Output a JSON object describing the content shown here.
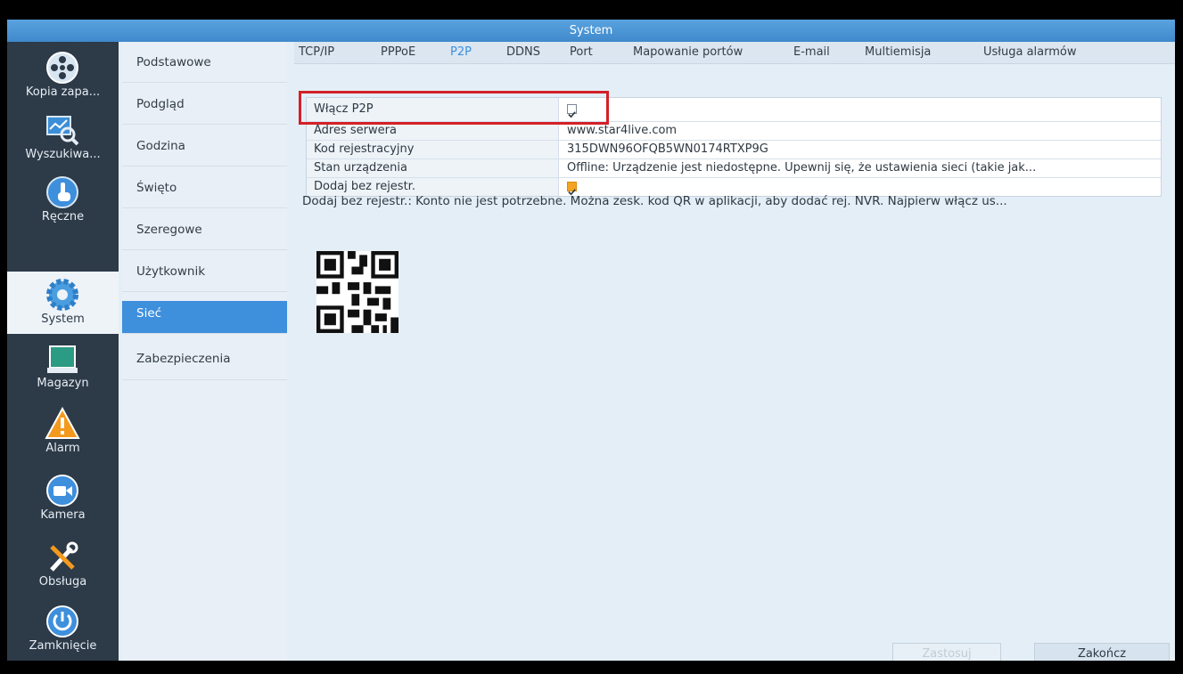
{
  "window": {
    "title": "System"
  },
  "rail": {
    "items": [
      {
        "label": "Kopia zapa...",
        "icon": "backup-reel-icon"
      },
      {
        "label": "Wyszukiwa...",
        "icon": "search-chart-icon"
      },
      {
        "label": "Ręczne",
        "icon": "hand-pointer-icon"
      },
      {
        "label": "System",
        "icon": "gear-icon"
      },
      {
        "label": "Magazyn",
        "icon": "storage-icon"
      },
      {
        "label": "Alarm",
        "icon": "warning-icon"
      },
      {
        "label": "Kamera",
        "icon": "camera-icon"
      },
      {
        "label": "Obsługa",
        "icon": "tools-icon"
      },
      {
        "label": "Zamknięcie",
        "icon": "power-icon"
      }
    ]
  },
  "categories": {
    "items": [
      {
        "label": "Podstawowe"
      },
      {
        "label": "Podgląd"
      },
      {
        "label": "Godzina"
      },
      {
        "label": "Święto"
      },
      {
        "label": "Szeregowe"
      },
      {
        "label": "Użytkownik"
      },
      {
        "label": "Sieć"
      },
      {
        "label": "Zabezpieczenia"
      }
    ]
  },
  "tabs": {
    "items": [
      {
        "label": "TCP/IP"
      },
      {
        "label": "PPPoE"
      },
      {
        "label": "P2P"
      },
      {
        "label": "DDNS"
      },
      {
        "label": "Port"
      },
      {
        "label": "Mapowanie portów"
      },
      {
        "label": "E-mail"
      },
      {
        "label": "Multiemisja"
      },
      {
        "label": "Usługa alarmów"
      }
    ]
  },
  "p2p": {
    "rows": [
      {
        "label": "Włącz P2P",
        "value": ""
      },
      {
        "label": "Adres serwera",
        "value": "www.star4live.com"
      },
      {
        "label": "Kod rejestracyjny",
        "value": "315DWN96OFQB5WN0174RTXP9G"
      },
      {
        "label": "Stan urządzenia",
        "value": "Offline: Urządzenie jest niedostępne. Upewnij się, że ustawienia sieci (takie jak..."
      },
      {
        "label": "Dodaj bez rejestr.",
        "value": ""
      }
    ],
    "note": "Dodaj bez rejestr.: Konto nie jest potrzebne. Można zesk. kod QR w aplikacji, aby dodać rej. NVR. Najpierw włącz us..."
  },
  "buttons": {
    "apply": "Zastosuj",
    "finish": "Zakończ"
  },
  "colors": {
    "accent": "#3e8fdc",
    "highlight": "#d32027",
    "rail": "#2d3a48"
  }
}
